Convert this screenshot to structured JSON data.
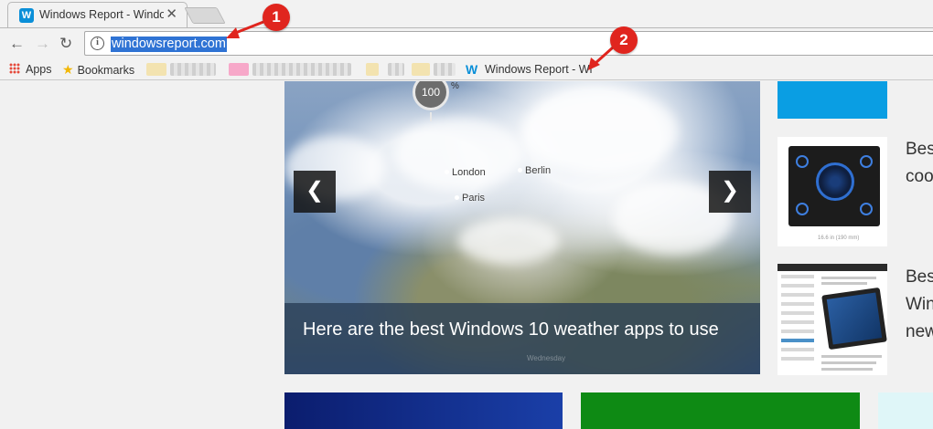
{
  "browser": {
    "tab_title": "Windows Report - Windo",
    "tab_favicon": "W",
    "tab_close": "✕",
    "back": "←",
    "forward": "→",
    "reload": "↻",
    "info_icon": "i",
    "url": "windowsreport.com"
  },
  "bookmarks": {
    "apps_label": "Apps",
    "bookmarks_label": "Bookmarks",
    "wr_label": "Windows Report - Wi",
    "wr_icon": "W"
  },
  "slider": {
    "zoom_value": "100",
    "zoom_unit": "%",
    "cities": [
      "London",
      "Berlin",
      "Paris"
    ],
    "caption": "Here are the best Windows 10 weather apps to use",
    "caption_sub": "Wednesday",
    "prev": "❮",
    "next": "❯"
  },
  "sidebar": {
    "item1_lines": [
      "Best",
      "coo"
    ],
    "item2_lines": [
      "Best",
      "Win",
      "new"
    ],
    "thumb1_caption": "16.6 in (190 mm)"
  },
  "annotations": {
    "badge1": "1",
    "badge2": "2",
    "color": "#e0251e"
  }
}
